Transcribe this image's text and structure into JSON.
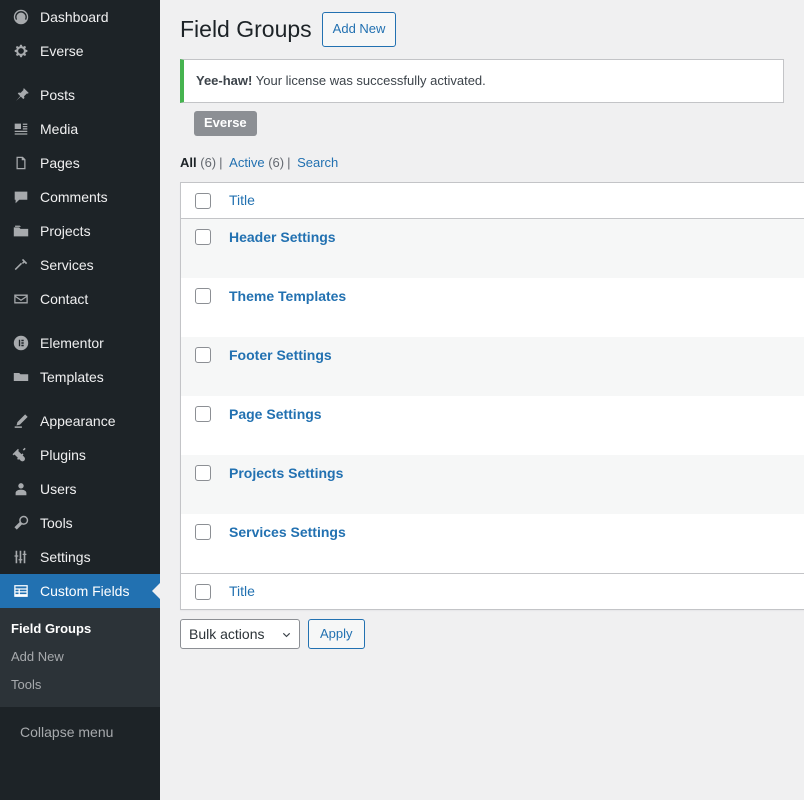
{
  "sidebar": {
    "items": [
      {
        "label": "Dashboard",
        "icon": "dashboard-icon",
        "current": false
      },
      {
        "label": "Everse",
        "icon": "gear-icon",
        "current": false
      },
      {
        "label": "Posts",
        "icon": "pin-icon",
        "current": false
      },
      {
        "label": "Media",
        "icon": "media-icon",
        "current": false
      },
      {
        "label": "Pages",
        "icon": "pages-icon",
        "current": false
      },
      {
        "label": "Comments",
        "icon": "comments-icon",
        "current": false
      },
      {
        "label": "Projects",
        "icon": "portfolio-icon",
        "current": false
      },
      {
        "label": "Services",
        "icon": "hammer-icon",
        "current": false
      },
      {
        "label": "Contact",
        "icon": "email-icon",
        "current": false
      },
      {
        "label": "Elementor",
        "icon": "elementor-icon",
        "current": false
      },
      {
        "label": "Templates",
        "icon": "folder-icon",
        "current": false
      },
      {
        "label": "Appearance",
        "icon": "appearance-icon",
        "current": false
      },
      {
        "label": "Plugins",
        "icon": "plugins-icon",
        "current": false
      },
      {
        "label": "Users",
        "icon": "users-icon",
        "current": false
      },
      {
        "label": "Tools",
        "icon": "tools-icon",
        "current": false
      },
      {
        "label": "Settings",
        "icon": "settings-icon",
        "current": false
      },
      {
        "label": "Custom Fields",
        "icon": "custom-fields-icon",
        "current": true
      }
    ],
    "submenu": [
      {
        "label": "Field Groups",
        "current": true
      },
      {
        "label": "Add New",
        "current": false
      },
      {
        "label": "Tools",
        "current": false
      }
    ],
    "collapse": {
      "label": "Collapse menu",
      "icon": "collapse-arrow-icon"
    },
    "colors": {
      "background": "#1d2327",
      "submenu_background": "#2c3338",
      "current": "#2271b1"
    }
  },
  "header": {
    "title": "Field Groups",
    "add_new_label": "Add New"
  },
  "notice": {
    "strong": "Yee-haw!",
    "message": "Your license was successfully activated.",
    "accent_color": "#46b450"
  },
  "everse_pill": {
    "label": "Everse",
    "color": "#8c8f94"
  },
  "filters": {
    "items": [
      {
        "label": "All",
        "count": "(6)",
        "current": true
      },
      {
        "label": "Active",
        "count": "(6)",
        "current": false
      },
      {
        "label": "Search",
        "count": "",
        "current": false
      }
    ],
    "separator": "|"
  },
  "table": {
    "columns": [
      "Title"
    ],
    "rows": [
      {
        "title": "Header Settings"
      },
      {
        "title": "Theme Templates"
      },
      {
        "title": "Footer Settings"
      },
      {
        "title": "Page Settings"
      },
      {
        "title": "Projects Settings"
      },
      {
        "title": "Services Settings"
      }
    ]
  },
  "tablenav": {
    "bulk_selected": "Bulk actions",
    "bulk_options": [
      "Bulk actions"
    ],
    "apply_label": "Apply"
  }
}
